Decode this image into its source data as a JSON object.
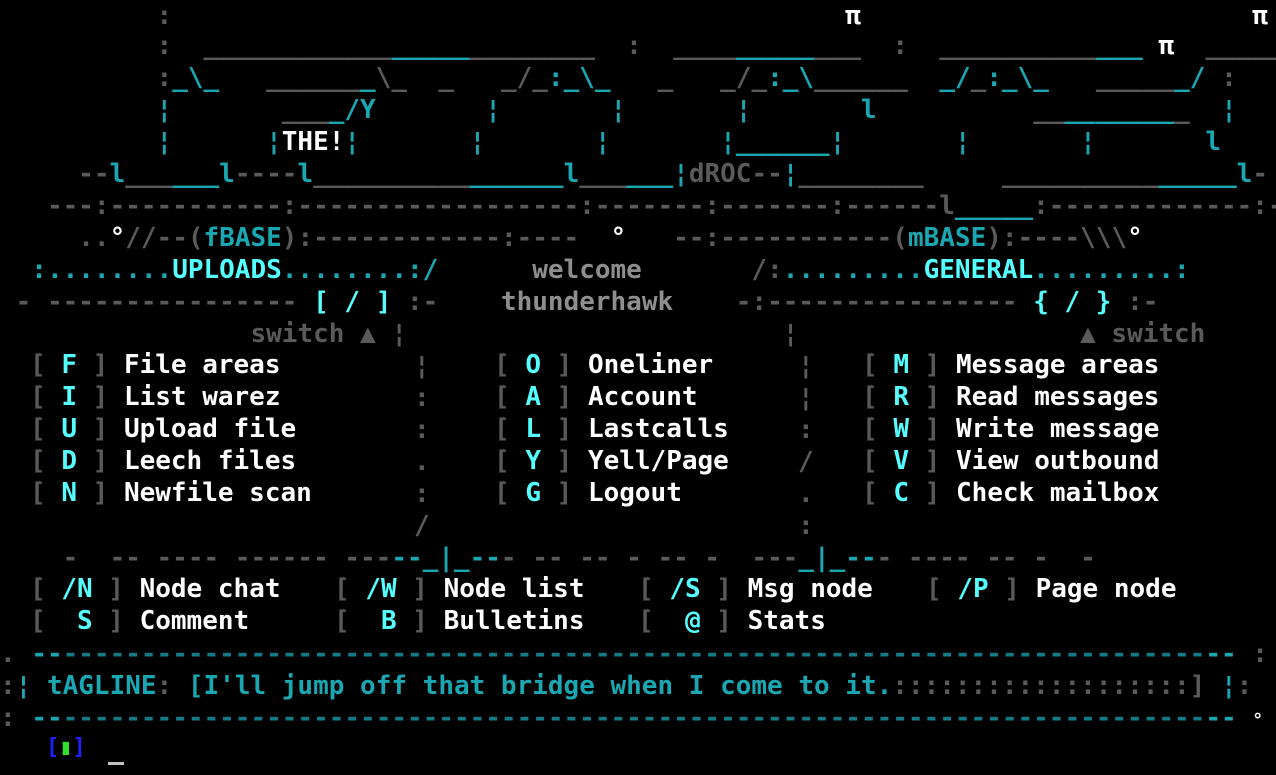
{
  "logo": {
    "art_lines": [
      "   :                                         :                                                   :",
      "   :  ____________   ______________________  :  ____________    _      ___________  ______       :",
      "   :_\\_   ________\\_   _   _/_:_\\_   _   _/_:_\\_______  _/_:_\\_   _______/",
      "   |       ____/Y       |       |       |       l           |        l",
      "   |      |THE!|        |       |       |_______|        |       |   l",
      " --l______l----l________________l_______|dROC--|__________|__________l-",
      " ---:-----------:-----------------:-------:-------:------l_______:-------------:-",
      "   ..°//--(fBASE):------------:----  °   --:----------(mBASE):----\\\\\\°"
    ],
    "the_label": "THE!",
    "droc_label": "dROC",
    "fbase_label": "fBASE",
    "mbase_label": "mBASE"
  },
  "header": {
    "welcome_line1": "welcome",
    "welcome_line2": "thunderhawk"
  },
  "uploads": {
    "title": "UPLOADS",
    "bracket_hint": "[ / ]",
    "switch_label": "switch ▲",
    "items": [
      {
        "key": "F",
        "label": "File areas"
      },
      {
        "key": "I",
        "label": "List warez"
      },
      {
        "key": "U",
        "label": "Upload file"
      },
      {
        "key": "D",
        "label": "Leech files"
      },
      {
        "key": "N",
        "label": "Newfile scan"
      }
    ]
  },
  "center": {
    "items": [
      {
        "key": "O",
        "label": "Oneliner"
      },
      {
        "key": "A",
        "label": "Account"
      },
      {
        "key": "L",
        "label": "Lastcalls"
      },
      {
        "key": "Y",
        "label": "Yell/Page"
      },
      {
        "key": "G",
        "label": "Logout"
      }
    ]
  },
  "general": {
    "title": "GENERAL",
    "bracket_hint": "{ / }",
    "switch_label": "▲ switch",
    "items": [
      {
        "key": "M",
        "label": "Message areas"
      },
      {
        "key": "R",
        "label": "Read messages"
      },
      {
        "key": "W",
        "label": "Write message"
      },
      {
        "key": "V",
        "label": "View outbound"
      },
      {
        "key": "C",
        "label": "Check mailbox"
      }
    ]
  },
  "bottom_commands": [
    {
      "key": "/N",
      "label": "Node chat"
    },
    {
      "key": "/W",
      "label": "Node list"
    },
    {
      "key": "/S",
      "label": "Msg node"
    },
    {
      "key": "/P",
      "label": "Page node"
    },
    {
      "key": "S",
      "label": "Comment"
    },
    {
      "key": "B",
      "label": "Bulletins"
    },
    {
      "key": "@",
      "label": "Stats"
    }
  ],
  "tagline": {
    "label": "tAGLINE",
    "text": "[I'll jump off that bridge when I come to it.",
    "fill": ":::::::::::::::::::]"
  },
  "prompt": {
    "indicator": "[▮]"
  },
  "colors": {
    "background": "#000000",
    "accent": "#55ffff",
    "teal": "#1aa7b2",
    "label": "#ffffff",
    "dim": "#5a5a5a"
  }
}
